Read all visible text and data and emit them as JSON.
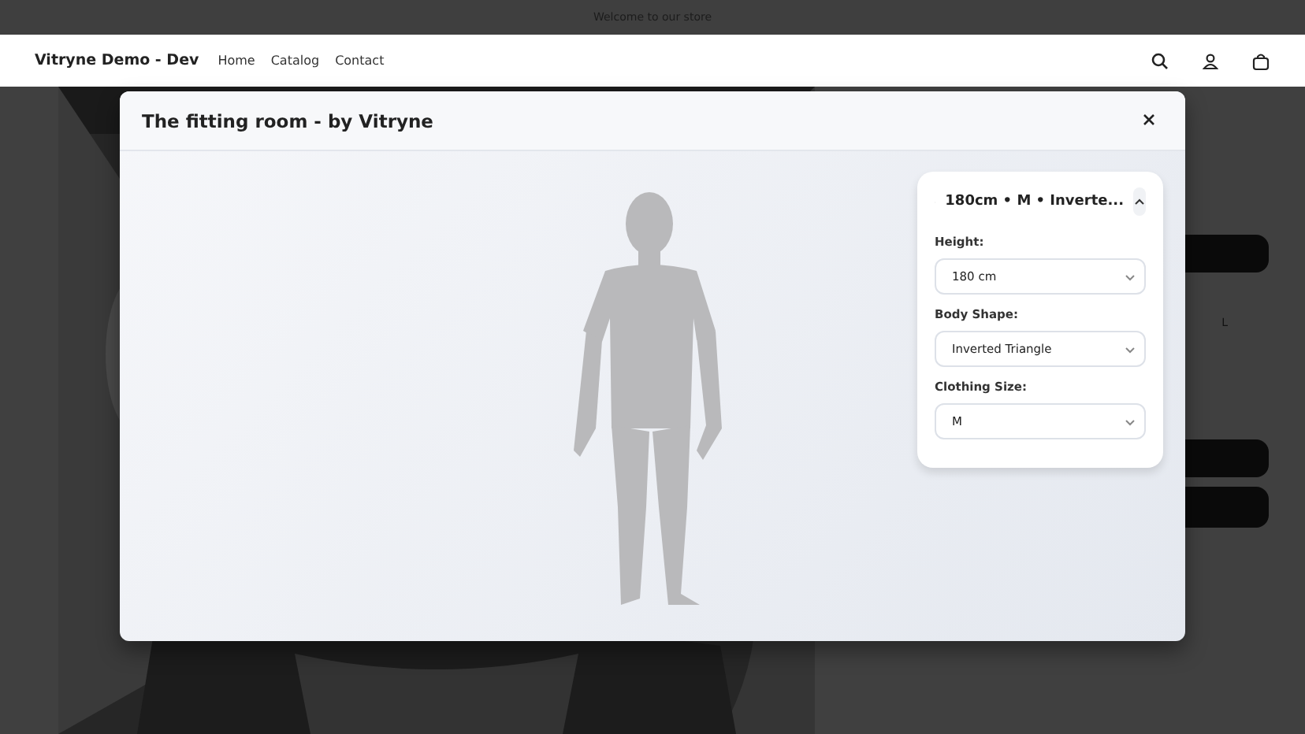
{
  "announcement": "Welcome to our store",
  "header": {
    "logo": "Vitryne Demo - Dev",
    "nav": [
      "Home",
      "Catalog",
      "Contact"
    ]
  },
  "product": {
    "size_option": "L"
  },
  "modal": {
    "title": "The fitting room - by Vitryne",
    "settings_panel": {
      "summary": "180cm • M • Inverte...",
      "expanded": true,
      "fields": [
        {
          "label": "Height:",
          "value": "180 cm"
        },
        {
          "label": "Body Shape:",
          "value": "Inverted Triangle"
        },
        {
          "label": "Clothing Size:",
          "value": "M"
        }
      ]
    }
  }
}
